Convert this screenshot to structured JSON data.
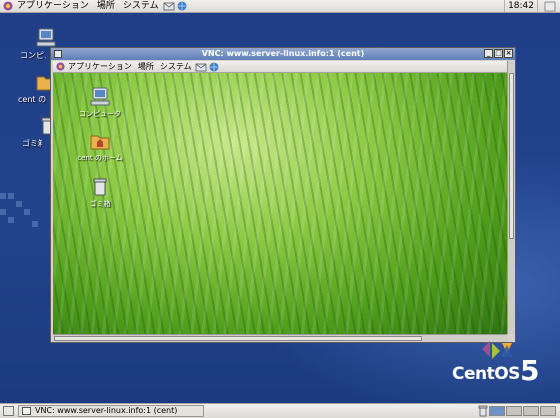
{
  "top_panel": {
    "menu_applications": "アプリケーション",
    "menu_places": "場所",
    "menu_system": "システム",
    "clock": "18:42"
  },
  "desktop_icons": {
    "computer": "コンピュータ",
    "home": "cent のホーム",
    "trash": "ゴミ箱"
  },
  "vnc_window": {
    "title": "VNC: www.server-linux.info:1 (cent)",
    "inner_menu_applications": "アプリケーション",
    "inner_menu_places": "場所",
    "inner_menu_system": "システム",
    "inner_icons": {
      "computer": "コンピュータ",
      "home": "cent のホーム",
      "trash": "ゴミ箱"
    }
  },
  "logo": {
    "text": "CentOS",
    "version": "5"
  },
  "taskbar": {
    "task_label": "VNC: www.server-linux.info:1 (cent)"
  },
  "colors": {
    "desktop": "#1d3f86",
    "panel": "#e6e4df",
    "titlebar": "#6f8ec3",
    "grass": "#6db52e"
  }
}
